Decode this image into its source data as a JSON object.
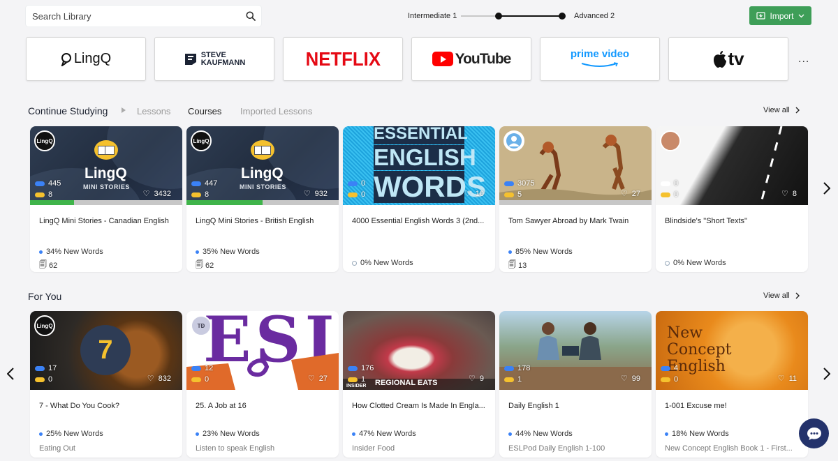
{
  "search": {
    "placeholder": "Search Library"
  },
  "level": {
    "from": "Intermediate 1",
    "to": "Advanced 2"
  },
  "import": {
    "label": "Import"
  },
  "providers": [
    {
      "name": "LingQ",
      "icon": "lingq-logo"
    },
    {
      "name": "STEVE KAUFMANN",
      "line1": "STEVE",
      "line2": "KAUFMANN",
      "icon": "steve-kaufmann-logo"
    },
    {
      "name": "NETFLIX",
      "icon": "netflix-logo"
    },
    {
      "name": "YouTube",
      "icon": "youtube-logo"
    },
    {
      "name": "prime video",
      "icon": "prime-video-logo"
    },
    {
      "name": "tv",
      "icon": "apple-tv-logo"
    }
  ],
  "more": "...",
  "continue": {
    "title": "Continue Studying",
    "tabs": [
      "Lessons",
      "Courses",
      "Imported Lessons"
    ],
    "active_tab": "Courses",
    "view_all": "View all",
    "cards": [
      {
        "words": "445",
        "lingqs": "8",
        "likes": "3432",
        "progress": 0.29,
        "title": "LingQ Mini Stories - Canadian English",
        "new_words": "34% New Words",
        "count": "62",
        "logo": "LingQ",
        "mini": "MINI STORIES"
      },
      {
        "words": "447",
        "lingqs": "8",
        "likes": "932",
        "progress": 0.5,
        "title": "LingQ Mini Stories - British English",
        "new_words": "35% New Words",
        "count": "62",
        "logo": "LingQ",
        "mini": "MINI STORIES"
      },
      {
        "words": "0",
        "lingqs": "0",
        "likes": "10",
        "title": "4000 Essential English Words 3 (2nd...",
        "new_words": "0% New Words",
        "art": [
          "ESSENTIAL",
          "ENGLISH",
          "WORDS"
        ]
      },
      {
        "words": "3075",
        "lingqs": "5",
        "likes": "27",
        "title": "Tom Sawyer Abroad by Mark Twain",
        "new_words": "85% New Words",
        "count": "13"
      },
      {
        "words": "0",
        "lingqs": "0",
        "likes": "8",
        "title": "Blindside's \"Short Texts\"",
        "new_words": "0% New Words"
      }
    ]
  },
  "foryou": {
    "title": "For You",
    "view_all": "View all",
    "cards": [
      {
        "words": "17",
        "lingqs": "0",
        "likes": "832",
        "title": "7 - What Do You Cook?",
        "new_words": "25% New Words",
        "sub": "Eating Out",
        "art": "7"
      },
      {
        "words": "12",
        "lingqs": "0",
        "likes": "27",
        "title": "25. A Job at 16",
        "new_words": "23% New Words",
        "sub": "Listen to speak English",
        "avatar": "TĐ",
        "art": "ESL"
      },
      {
        "words": "176",
        "lingqs": "1",
        "likes": "9",
        "title": "How Clotted Cream Is Made In Engla...",
        "new_words": "47% New Words",
        "sub": "Insider Food",
        "art": "REGIONAL EATS",
        "brand": "INSIDER"
      },
      {
        "words": "178",
        "lingqs": "1",
        "likes": "99",
        "title": "Daily English 1",
        "new_words": "44% New Words",
        "sub": "ESLPod Daily English 1-100"
      },
      {
        "words": "4",
        "lingqs": "0",
        "likes": "11",
        "title": "1-001 Excuse me!",
        "new_words": "18% New Words",
        "sub": "New Concept English Book 1 - First...",
        "art": [
          "New",
          "Concept",
          "English"
        ]
      }
    ]
  },
  "colors": {
    "accent_green": "#3e9e58",
    "blue": "#3b82f6",
    "yellow": "#f5c12e",
    "chat": "#23326b"
  }
}
